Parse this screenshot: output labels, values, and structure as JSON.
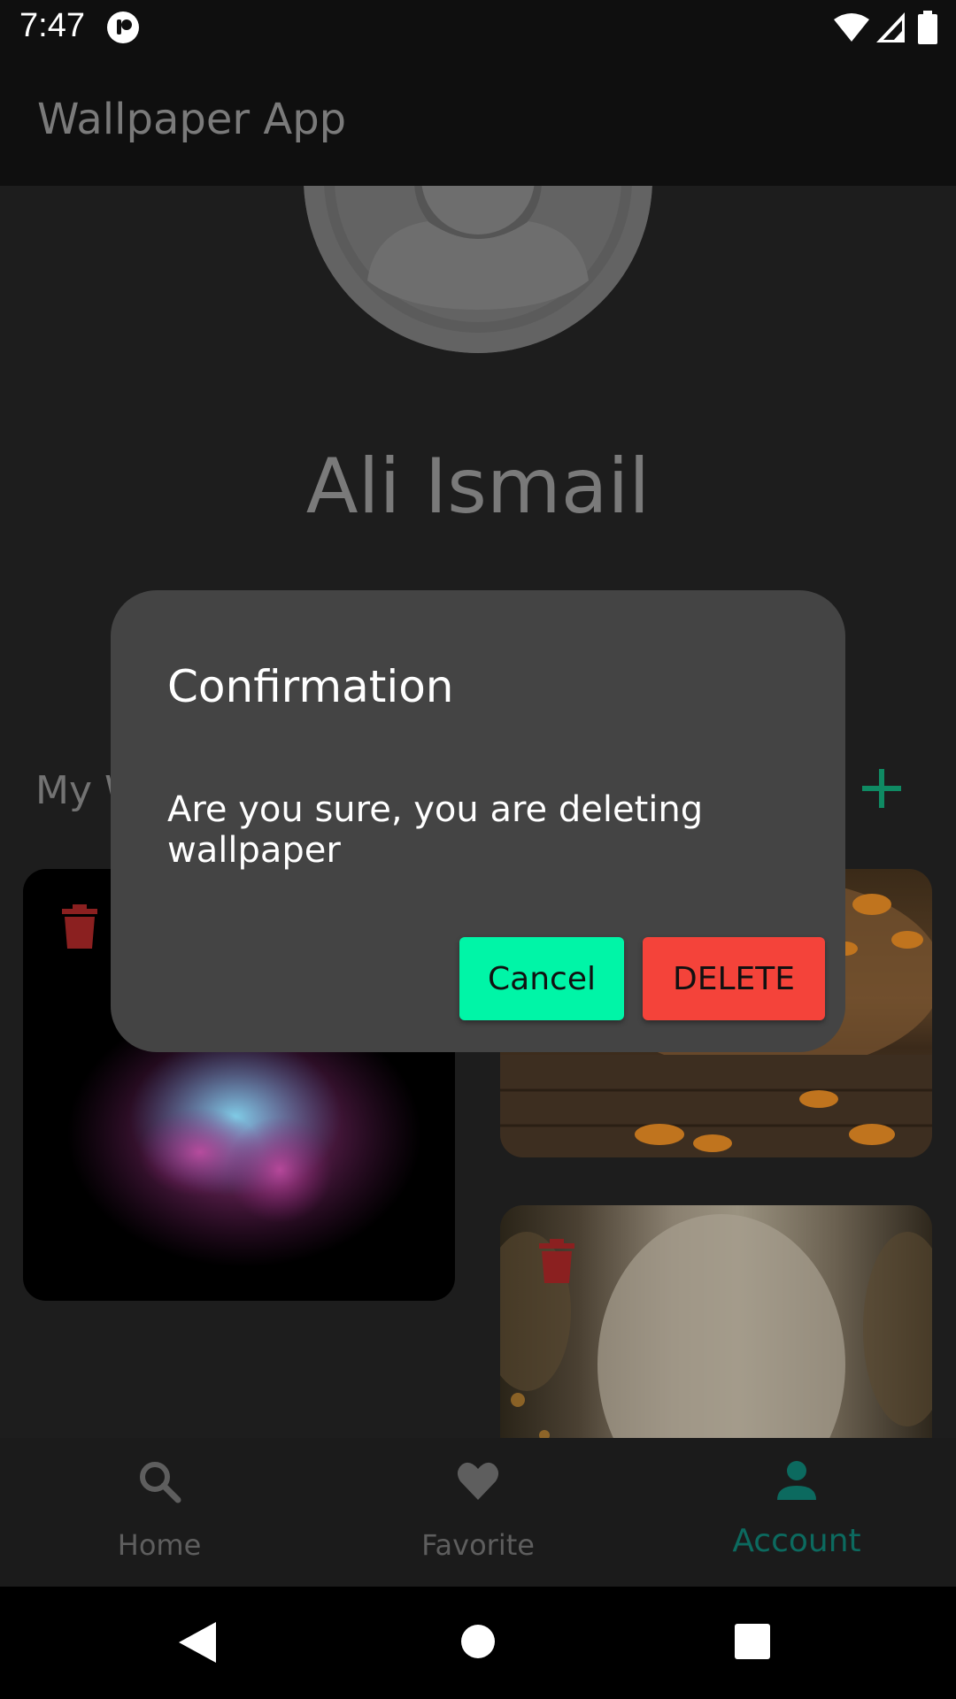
{
  "status_bar": {
    "time": "7:47",
    "icons": [
      "notification-icon",
      "wifi-icon",
      "signal-icon",
      "battery-icon"
    ]
  },
  "app_bar": {
    "title": "Wallpaper App"
  },
  "profile": {
    "name": "Ali Ismail"
  },
  "section": {
    "title": "My Wallpapers"
  },
  "bottom_nav": {
    "items": [
      {
        "label": "Home",
        "icon": "search-icon"
      },
      {
        "label": "Favorite",
        "icon": "heart-icon"
      },
      {
        "label": "Account",
        "icon": "person-icon",
        "active": true
      }
    ]
  },
  "dialog": {
    "title": "Confirmation",
    "message": "Are you sure, you are deleting wallpaper",
    "cancel_label": "Cancel",
    "delete_label": "DELETE"
  },
  "colors": {
    "accent": "#0c6a5f",
    "add_icon": "#0f8a63",
    "cancel_button": "#00f5a7",
    "delete_button": "#f4433a",
    "trash_icon": "#8b2020",
    "dialog_background": "#444444"
  }
}
